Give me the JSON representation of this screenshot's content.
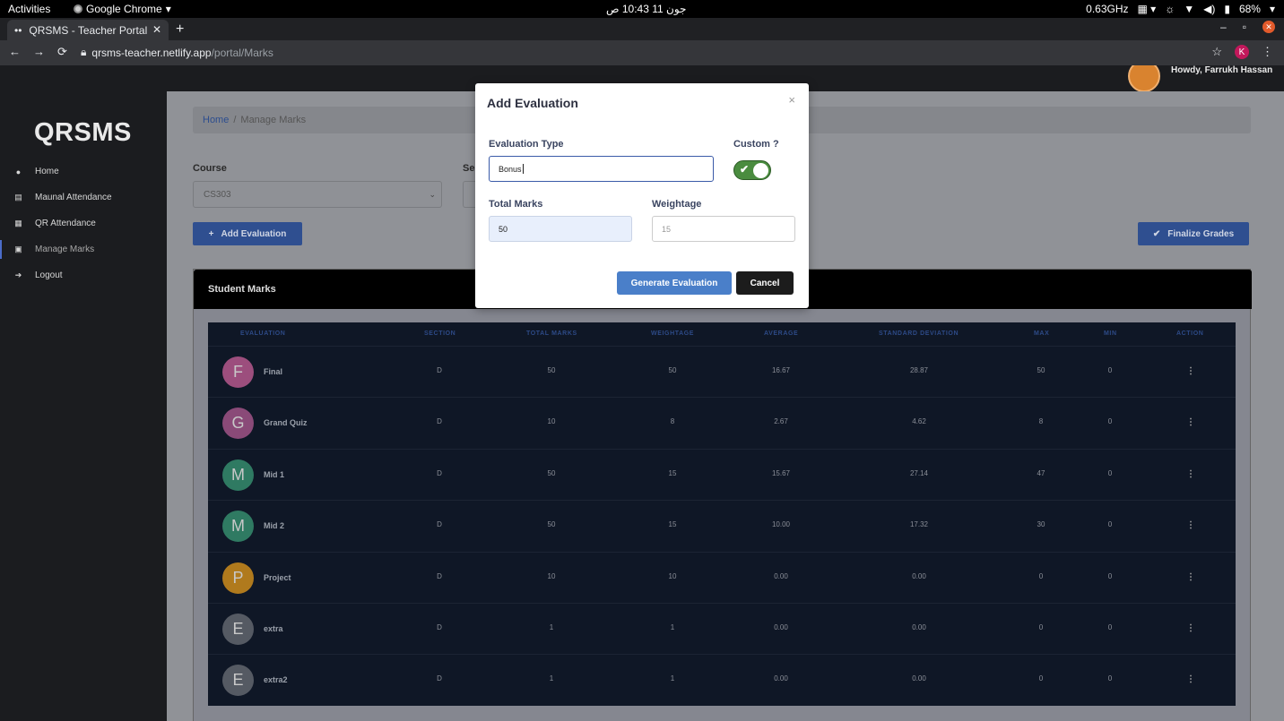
{
  "os": {
    "activities": "Activities",
    "app_name": "Google Chrome",
    "clock": "جون 11  10:43 ص",
    "cpu": "0.63GHz",
    "battery": "68%"
  },
  "browser": {
    "tab_title": "QRSMS - Teacher Portal",
    "url_host": "qrsms-teacher.netlify.app",
    "url_path": "/portal/Marks",
    "profile_initial": "K"
  },
  "app": {
    "brand": "QRSMS",
    "greeting": "Howdy, Farrukh Hassan",
    "menu": [
      {
        "label": "Home",
        "icon": "user-circle-icon"
      },
      {
        "label": "Maunal Attendance",
        "icon": "clipboard-icon"
      },
      {
        "label": "QR Attendance",
        "icon": "qr-code-icon"
      },
      {
        "label": "Manage Marks",
        "icon": "grade-book-icon",
        "active": true
      },
      {
        "label": "Logout",
        "icon": "sign-out-icon"
      }
    ],
    "breadcrumb": {
      "home": "Home",
      "separator": "/",
      "current": "Manage Marks"
    },
    "course_label": "Course",
    "course_value": "CS303",
    "section_label": "Se",
    "add_evaluation_label": "Add Evaluation",
    "finalize_label": "Finalize Grades"
  },
  "table": {
    "title": "Student Marks",
    "headers": [
      "EVALUATION",
      "SECTION",
      "TOTAL MARKS",
      "WEIGHTAGE",
      "AVERAGE",
      "STANDARD DEVIATION",
      "MAX",
      "MIN",
      "ACTION"
    ],
    "rows": [
      {
        "initial": "F",
        "name": "Final",
        "section": "D",
        "total": "50",
        "weightage": "50",
        "average": "16.67",
        "stddev": "28.87",
        "max": "50",
        "min": "0",
        "color": "#9c4e7d"
      },
      {
        "initial": "G",
        "name": "Grand Quiz",
        "section": "D",
        "total": "10",
        "weightage": "8",
        "average": "2.67",
        "stddev": "4.62",
        "max": "8",
        "min": "0",
        "color": "#8a4a78"
      },
      {
        "initial": "M",
        "name": "Mid 1",
        "section": "D",
        "total": "50",
        "weightage": "15",
        "average": "15.67",
        "stddev": "27.14",
        "max": "47",
        "min": "0",
        "color": "#2f7a62"
      },
      {
        "initial": "M",
        "name": "Mid 2",
        "section": "D",
        "total": "50",
        "weightage": "15",
        "average": "10.00",
        "stddev": "17.32",
        "max": "30",
        "min": "0",
        "color": "#2f7a62"
      },
      {
        "initial": "P",
        "name": "Project",
        "section": "D",
        "total": "10",
        "weightage": "10",
        "average": "0.00",
        "stddev": "0.00",
        "max": "0",
        "min": "0",
        "color": "#b07a1d"
      },
      {
        "initial": "E",
        "name": "extra",
        "section": "D",
        "total": "1",
        "weightage": "1",
        "average": "0.00",
        "stddev": "0.00",
        "max": "0",
        "min": "0",
        "color": "#555a63"
      },
      {
        "initial": "E",
        "name": "extra2",
        "section": "D",
        "total": "1",
        "weightage": "1",
        "average": "0.00",
        "stddev": "0.00",
        "max": "0",
        "min": "0",
        "color": "#555a63"
      }
    ]
  },
  "modal": {
    "title": "Add Evaluation",
    "close": "×",
    "type_label": "Evaluation Type",
    "type_value": "Bonus",
    "custom_label": "Custom ?",
    "custom_on": true,
    "total_label": "Total Marks",
    "total_value": "50",
    "weight_label": "Weightage",
    "weight_placeholder": "15",
    "generate_label": "Generate Evaluation",
    "cancel_label": "Cancel"
  }
}
